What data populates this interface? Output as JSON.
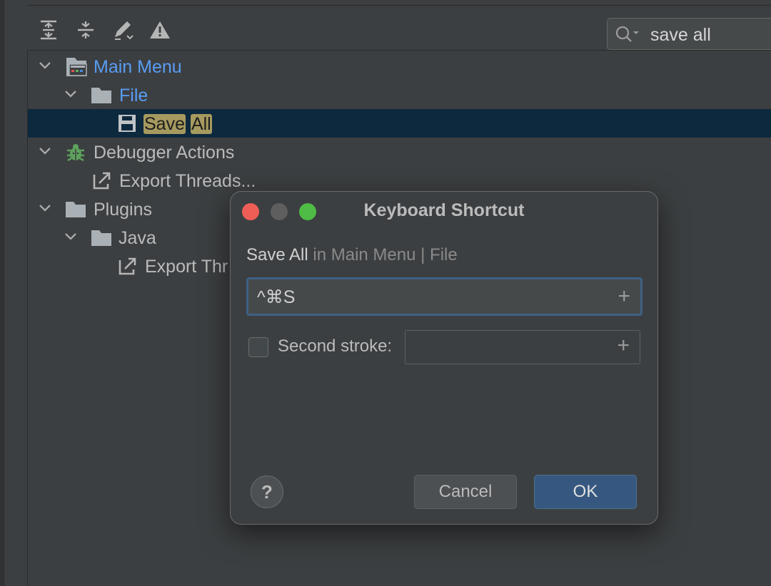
{
  "toolbar": {
    "icons": [
      "expand-all-icon",
      "collapse-all-icon",
      "edit-shortcut-icon",
      "conflicts-warning-icon"
    ]
  },
  "search": {
    "value": "save all"
  },
  "tree": {
    "main_menu": "Main Menu",
    "file": "File",
    "save": "Save",
    "all": "All",
    "debugger_actions": "Debugger Actions",
    "export_threads_1": "Export Threads...",
    "plugins": "Plugins",
    "java": "Java",
    "export_threads_2": "Export Thr"
  },
  "dialog": {
    "title": "Keyboard Shortcut",
    "action_name": "Save All",
    "in_label": " in Main Menu",
    "separator": " | ",
    "group": "File",
    "shortcut": "^⌘S",
    "plus": "+",
    "second_stroke_label": "Second stroke:",
    "second_stroke_checked": false,
    "help": "?",
    "cancel": "Cancel",
    "ok": "OK"
  },
  "colors": {
    "background": "#3c3f41",
    "selection": "#0d293e",
    "link_blue": "#589df6",
    "highlight": "#a69a5f",
    "ok_button": "#365880",
    "close": "#ee5e57",
    "minimize": "#5e5e5e",
    "zoom": "#4ebc45"
  }
}
